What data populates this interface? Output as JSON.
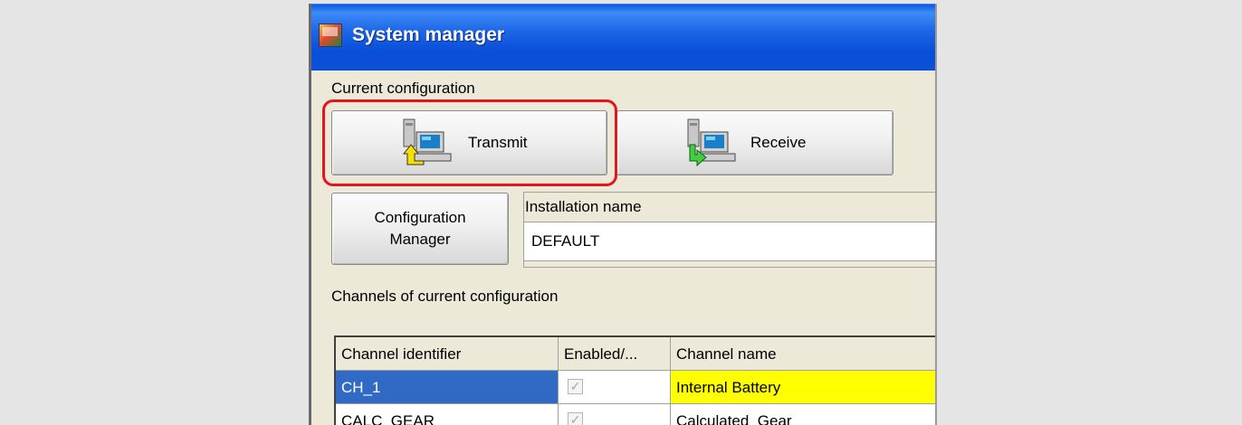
{
  "window": {
    "title": "System manager"
  },
  "current_configuration": {
    "label": "Current configuration",
    "transmit_label": "Transmit",
    "receive_label": "Receive"
  },
  "configuration_manager": {
    "line1": "Configuration",
    "line2": "Manager"
  },
  "installation": {
    "label": "Installation name",
    "value": "DEFAULT"
  },
  "channels": {
    "label": "Channels of current configuration",
    "columns": [
      "Channel identifier",
      "Enabled/...",
      "Channel name"
    ],
    "rows": [
      {
        "id": "CH_1",
        "enabled": "✓",
        "name": "Internal Battery"
      },
      {
        "id": "CALC_GEAR",
        "enabled": "✓",
        "name": "Calculated_Gear"
      }
    ]
  },
  "colors": {
    "selected_row": "#316ac5",
    "highlight_name": "#ffff00",
    "annotation": "#e8141b"
  },
  "icons": {
    "app": "system-manager-app-icon",
    "transmit": "computer-upload-arrow-icon",
    "receive": "computer-download-arrow-icon"
  }
}
